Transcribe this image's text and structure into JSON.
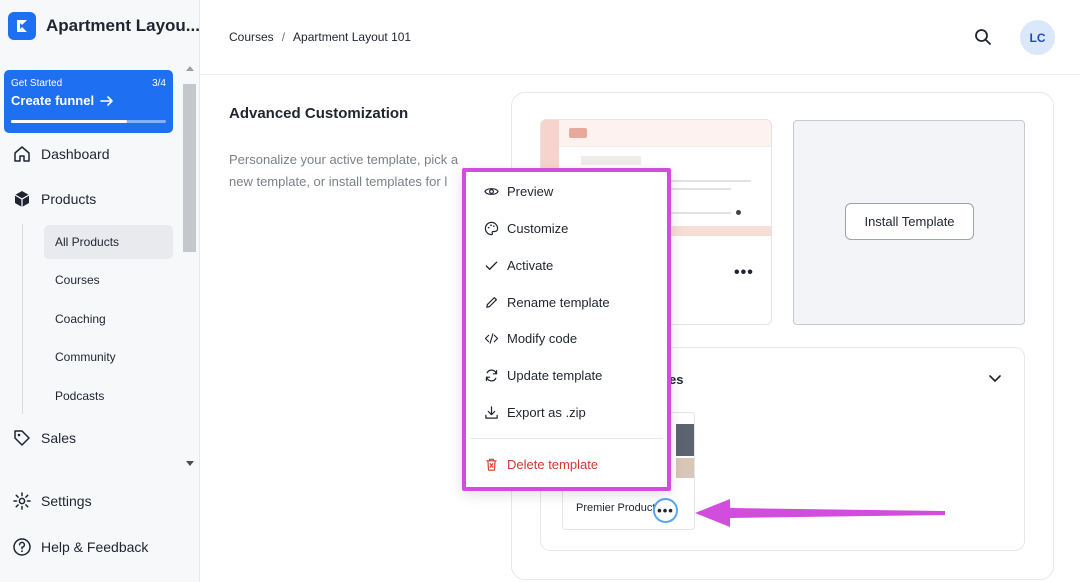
{
  "app": {
    "title": "Apartment Layou...",
    "brand_color": "#1e6ff1"
  },
  "funnel": {
    "label": "Get Started",
    "progress_text": "3/4",
    "progress_fraction": 0.75,
    "title": "Create funnel"
  },
  "sidebar": {
    "items": [
      {
        "label": "Dashboard",
        "icon": "home-icon"
      },
      {
        "label": "Products",
        "icon": "box-icon"
      },
      {
        "label": "Sales",
        "icon": "tag-icon"
      }
    ],
    "sub_items": [
      {
        "label": "All Products",
        "active": true
      },
      {
        "label": "Courses",
        "active": false
      },
      {
        "label": "Coaching",
        "active": false
      },
      {
        "label": "Community",
        "active": false
      },
      {
        "label": "Podcasts",
        "active": false
      }
    ],
    "bottom": [
      {
        "label": "Settings",
        "icon": "gear-icon"
      },
      {
        "label": "Help & Feedback",
        "icon": "help-icon"
      }
    ]
  },
  "header": {
    "breadcrumb": [
      "Courses",
      "Apartment Layout 101"
    ],
    "separator": "/",
    "avatar_initials": "LC"
  },
  "main": {
    "section_title": "Advanced Customization",
    "section_desc": "Personalize your active template, pick a new template, or install templates for l",
    "install_button": "Install Template",
    "library_title_partial": "es",
    "library_card_label": "Premier Product",
    "more_dots": "•••"
  },
  "menu": {
    "items": [
      {
        "label": "Preview",
        "icon": "eye-icon"
      },
      {
        "label": "Customize",
        "icon": "palette-icon"
      },
      {
        "label": "Activate",
        "icon": "check-icon"
      },
      {
        "label": "Rename template",
        "icon": "pencil-icon"
      },
      {
        "label": "Modify code",
        "icon": "code-icon"
      },
      {
        "label": "Update template",
        "icon": "refresh-icon"
      },
      {
        "label": "Export as .zip",
        "icon": "download-icon"
      }
    ],
    "danger_item": {
      "label": "Delete template",
      "icon": "trash-icon",
      "color": "#d23a2f"
    },
    "highlight_color": "#d14ddb"
  },
  "annotation": {
    "arrow_color": "#d14ddb"
  }
}
